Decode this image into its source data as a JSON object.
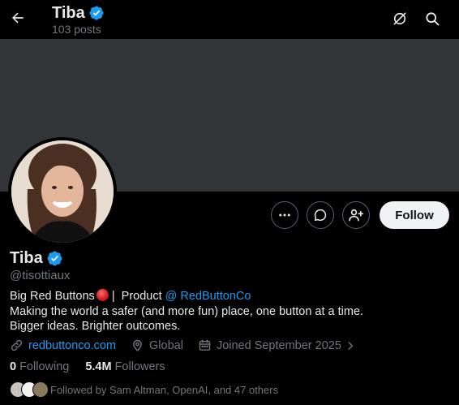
{
  "topbar": {
    "name": "Tiba",
    "posts": "103 posts"
  },
  "profile": {
    "display_name": "Tiba",
    "handle": "@tisottiaux",
    "follow_label": "Follow",
    "bio": {
      "line1_part1": "Big Red Buttons",
      "line1_sep": " |  Product ",
      "line1_link": "@ RedButtonCo",
      "line2": "Making the world a safer (and more fun) place, one button at a time.",
      "line3": "Bigger ideas. Brighter outcomes."
    },
    "website": "redbuttonco.com",
    "location": "Global",
    "joined": "Joined September 2025",
    "following_count": "0",
    "following_label": "Following",
    "followers_count": "5.4M",
    "followers_label": "Followers",
    "followed_by": "Followed by Sam Altman, OpenAI, and 47 others"
  },
  "colors": {
    "accent": "#1d9bf0",
    "verified": "#1d9bf0",
    "banner": "#333639",
    "muted": "#71767b"
  },
  "icons": [
    "back-arrow-icon",
    "verified-badge-icon",
    "grok-icon",
    "search-icon",
    "more-icon",
    "message-icon",
    "add-user-icon",
    "link-icon",
    "location-icon",
    "calendar-icon",
    "chevron-right-icon"
  ]
}
